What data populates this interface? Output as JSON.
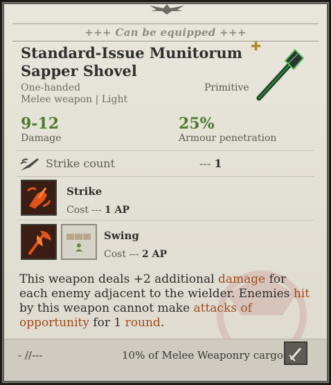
{
  "banner": "+++ Can be equipped +++",
  "item": {
    "name": "Standard-Issue Munitorum Sapper Shovel",
    "handedness": "One-handed",
    "category": "Melee weapon | Light",
    "quality": "Primitive"
  },
  "stats": {
    "damage_value": "9-12",
    "damage_label": "Damage",
    "armour_pen_value": "25%",
    "armour_pen_label": "Armour penetration"
  },
  "strike_count": {
    "label": "Strike count",
    "prefix": "---",
    "value": "1"
  },
  "abilities": [
    {
      "name": "Strike",
      "cost_prefix": "Cost ---",
      "cost": "1 AP"
    },
    {
      "name": "Swing",
      "cost_prefix": "Cost ---",
      "cost": "2 AP"
    }
  ],
  "description": {
    "p1": "This weapon deals +2 additional ",
    "kw1": "damage",
    "p2": " for each enemy adjacent to the wielder. Enemies ",
    "kw2": "hit",
    "p3": " by this weapon cannot make ",
    "kw3": "attacks of opportunity",
    "p4": " for 1 ",
    "kw4": "round",
    "p5": "."
  },
  "footer": {
    "weight": "- //---",
    "cargo": "10% of Melee Weaponry cargo"
  },
  "icons": {
    "top": "eagle-emblem-icon",
    "quality": "cross-icon",
    "item": "shovel-icon",
    "strike_count": "knife-strike-icon",
    "ability_strike": "strike-ability-icon",
    "ability_swing": "axe-swing-icon",
    "aim_pattern": "aim-pattern-icon",
    "cargo": "sword-cargo-icon"
  },
  "colors": {
    "stat_green": "#4c7a2e",
    "keyword": "#a04a1a",
    "ability_orange": "#e0541c"
  }
}
